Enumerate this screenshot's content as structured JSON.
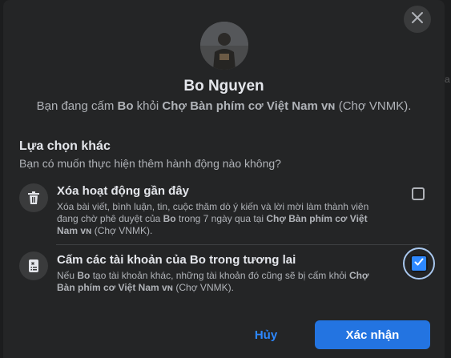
{
  "dialog": {
    "close_icon": "close-icon",
    "user_name": "Bo Nguyen",
    "subtitle": {
      "prefix": "Bạn đang cấm ",
      "user": "Bo",
      "middle": " khỏi ",
      "group": "Chợ Bàn phím cơ Việt Nam",
      "flag": "ᴠɴ",
      "suffix": " (Chợ VNMK)."
    },
    "section_title": "Lựa chọn khác",
    "section_subtitle": "Bạn có muốn thực hiện thêm hành động nào không?",
    "options": [
      {
        "icon": "trash-icon",
        "title": "Xóa hoạt động gần đây",
        "desc_line1": "Xóa bài viết, bình luận, tin, cuộc thăm dò ý kiến và lời mời làm thành viên",
        "desc_line2_prefix": "đang chờ phê duyệt của ",
        "desc_line2_user": "Bo",
        "desc_line2_mid": " trong 7 ngày qua tại ",
        "desc_line2_group": "Chợ Bàn phím cơ Việt",
        "desc_line3_group": "Nam ᴠɴ",
        "desc_line3_suffix": " (Chợ VNMK).",
        "checked": false
      },
      {
        "icon": "block-list-icon",
        "title": "Cấm các tài khoản của Bo trong tương lai",
        "desc_line1_prefix": "Nếu ",
        "desc_line1_user": "Bo",
        "desc_line1_mid": " tạo tài khoản khác, những tài khoản đó cũng sẽ bị cấm khỏi ",
        "desc_line1_group": "Chợ",
        "desc_line2_group": "Bàn phím cơ Việt Nam ᴠɴ",
        "desc_line2_suffix": " (Chợ VNMK).",
        "checked": true
      }
    ],
    "cancel_label": "Hủy",
    "confirm_label": "Xác nhận"
  },
  "colors": {
    "accent": "#2374e1",
    "link": "#2d88ff",
    "surface": "#242526"
  }
}
